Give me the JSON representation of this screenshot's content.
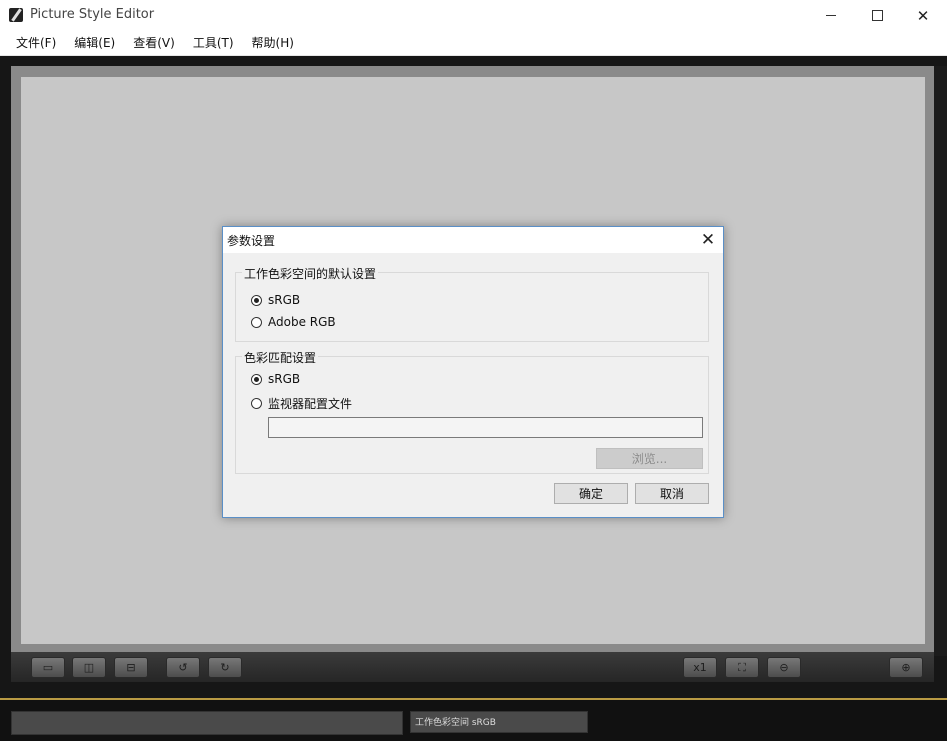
{
  "window": {
    "title": "Picture Style Editor",
    "controls": {
      "minimize": "—",
      "maximize": "☐",
      "close": "✕"
    }
  },
  "menubar": {
    "items": [
      {
        "label": "文件(F)"
      },
      {
        "label": "编辑(E)"
      },
      {
        "label": "查看(V)"
      },
      {
        "label": "工具(T)"
      },
      {
        "label": "帮助(H)"
      }
    ]
  },
  "toolbar": {
    "buttons": [
      {
        "name": "view-single-icon",
        "glyph": "▭"
      },
      {
        "name": "view-split-vertical-icon",
        "glyph": "◫"
      },
      {
        "name": "view-split-horizontal-icon",
        "glyph": "⊟"
      },
      {
        "name": "rotate-left-icon",
        "glyph": "↺"
      },
      {
        "name": "rotate-right-icon",
        "glyph": "↻"
      },
      {
        "name": "zoom-actual-icon",
        "glyph": "x1"
      },
      {
        "name": "fit-screen-icon",
        "glyph": "⛶"
      },
      {
        "name": "zoom-out-icon",
        "glyph": "⊖"
      },
      {
        "name": "zoom-in-icon",
        "glyph": "⊕"
      }
    ]
  },
  "statusbar": {
    "color_space": "工作色彩空间 sRGB"
  },
  "dialog": {
    "title": "参数设置",
    "close_glyph": "✕",
    "working_space_group": {
      "legend": "工作色彩空间的默认设置",
      "options": [
        {
          "label": "sRGB",
          "selected": true
        },
        {
          "label": "Adobe RGB",
          "selected": false
        }
      ]
    },
    "color_matching_group": {
      "legend": "色彩匹配设置",
      "options": [
        {
          "label": "sRGB",
          "selected": true
        },
        {
          "label": "监视器配置文件",
          "selected": false
        }
      ],
      "profile_path": "",
      "browse_label": "浏览..."
    },
    "ok_label": "确定",
    "cancel_label": "取消"
  },
  "colors": {
    "accent_border": "#5a8fc7",
    "gold_line": "#b99b44",
    "canvas": "#c7c7c7"
  }
}
